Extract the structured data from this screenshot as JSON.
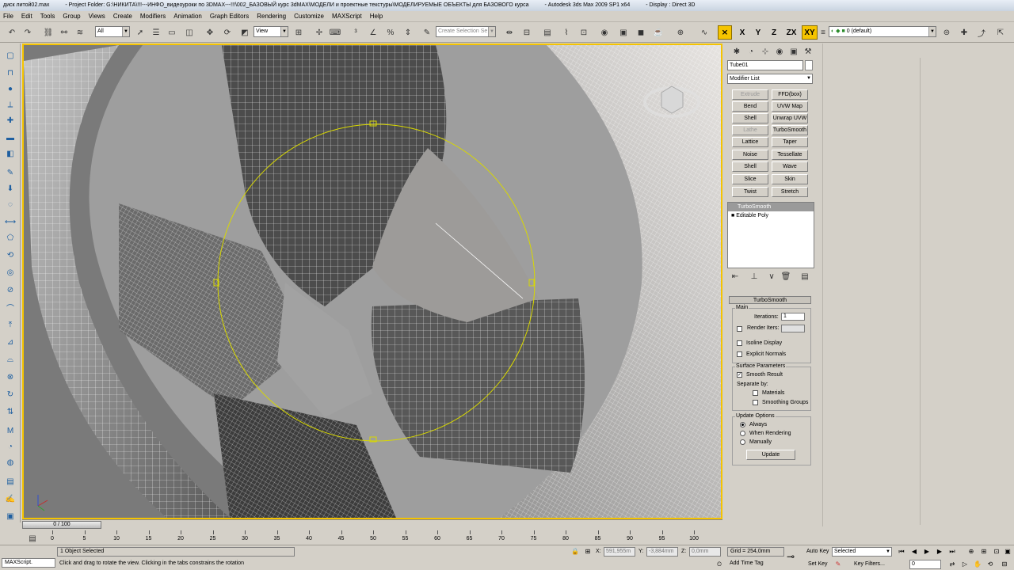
{
  "titlebar": {
    "file": "диск литой02.max",
    "project": "- Project Folder: G:\\НИКИТА\\!!!---ИНФО_видеоуроки по 3DMAX---!!!\\002_БАЗОВЫЙ курс 3dMAX\\МОДЕЛИ и проектные текстуры\\МОДЕЛИРУЕМЫЕ ОБЪЕКТЫ для БАЗОВОГО курса",
    "app": "- Autodesk 3ds Max  2009 SP1  x64",
    "display": "- Display : Direct 3D"
  },
  "menu": [
    "File",
    "Edit",
    "Tools",
    "Group",
    "Views",
    "Create",
    "Modifiers",
    "Animation",
    "Graph Editors",
    "Rendering",
    "Customize",
    "MAXScript",
    "Help"
  ],
  "toolbar": {
    "selection_filter": "All",
    "ref_coord": "View",
    "named_selection_placeholder": "Create Selection Se",
    "axis_x": "X",
    "axis_y": "Y",
    "axis_z": "Z",
    "axis_xy": "XY",
    "axis_zx": "ZX",
    "layer": "0 (default)"
  },
  "command_panel": {
    "object_name": "Tube01",
    "modifier_list": "Modifier List",
    "modifier_buttons": [
      {
        "left": "Extrude",
        "right": "FFD(box)",
        "left_disabled": true
      },
      {
        "left": "Bend",
        "right": "UVW Map"
      },
      {
        "left": "Shell",
        "right": "Unwrap UVW"
      },
      {
        "left": "Lathe",
        "right": "TurboSmooth",
        "left_disabled": true
      },
      {
        "left": "Lattice",
        "right": "Taper"
      },
      {
        "left": "Noise",
        "right": "Tessellate"
      },
      {
        "left": "Shell",
        "right": "Wave"
      },
      {
        "left": "Slice",
        "right": "Skin"
      },
      {
        "left": "Twist",
        "right": "Stretch"
      }
    ],
    "stack": [
      "TurboSmooth",
      "Editable Poly"
    ],
    "turbosmooth": {
      "title": "TurboSmooth",
      "main_group": "Main",
      "iterations_label": "Iterations:",
      "iterations_value": "1",
      "render_iters_label": "Render Iters:",
      "isoline_label": "Isoline Display",
      "explicit_label": "Explicit Normals",
      "surface_group": "Surface Parameters",
      "smooth_result": "Smooth Result",
      "separate_by": "Separate by:",
      "materials": "Materials",
      "smoothing_groups": "Smoothing Groups",
      "update_group": "Update Options",
      "always": "Always",
      "when_rendering": "When Rendering",
      "manually": "Manually",
      "update_button": "Update"
    }
  },
  "timeline": {
    "slider": "0 / 100",
    "ticks": [
      "0",
      "5",
      "10",
      "15",
      "20",
      "25",
      "30",
      "35",
      "40",
      "45",
      "50",
      "55",
      "60",
      "65",
      "70",
      "75",
      "80",
      "85",
      "90",
      "95",
      "100"
    ]
  },
  "status": {
    "maxscript": "MAXScript.",
    "selected": "1 Object Selected",
    "prompt": "Click and drag to rotate the view.  Clicking in the tabs constrains the rotation",
    "x": "591,955m",
    "y": "-3,884mm",
    "z": "0,0mm",
    "grid": "Grid = 254,0mm",
    "add_time_tag": "Add Time Tag",
    "auto_key": "Auto Key",
    "set_key": "Set Key",
    "key_mode": "Selected",
    "key_filters": "Key Filters...",
    "frame": "0"
  }
}
